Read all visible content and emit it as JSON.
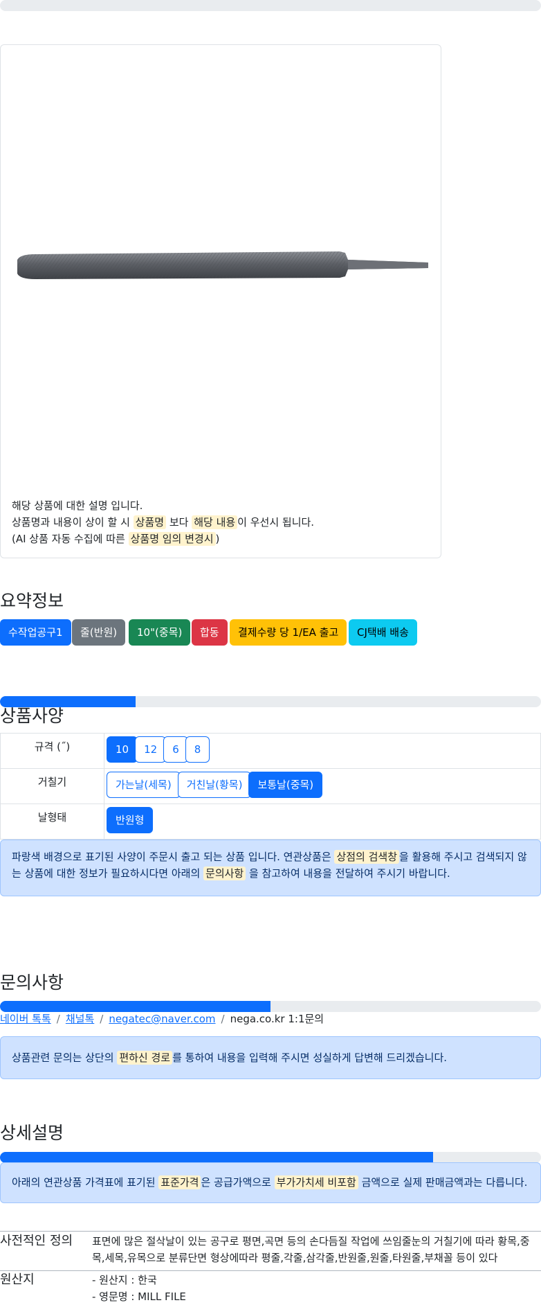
{
  "progress": {
    "top_fill": 0.0,
    "spec_fill": 0.25,
    "inquiry_fill": 0.5,
    "detail_fill": 0.8
  },
  "product_description": {
    "line1": "해당 상품에 대한 설명 입니다.",
    "line2_a": "상품명과 내용이 상이 할 시 ",
    "line2_hl1": "상품명",
    "line2_b": " 보다 ",
    "line2_hl2": "해당 내용",
    "line2_c": "이 우선시 됩니다.",
    "line3_a": "(AI 상품 자동 수집에 따른 ",
    "line3_hl": "상품명 임의 변경시",
    "line3_b": ")"
  },
  "summary": {
    "heading": "요약정보",
    "badges": [
      {
        "label": "수작업공구1",
        "color": "#0d6efd",
        "text_color": "#ffffff"
      },
      {
        "label": "줄(반원)",
        "color": "#6c757d",
        "text_color": "#ffffff"
      },
      {
        "label": "10\"(중목)",
        "color": "#198754",
        "text_color": "#ffffff"
      },
      {
        "label": "합동",
        "color": "#dc3545",
        "text_color": "#ffffff"
      },
      {
        "label": "결제수량 당 1/EA 출고",
        "color": "#ffc107",
        "text_color": "#000000"
      },
      {
        "label": "CJ택배 배송",
        "color": "#0dcaf0",
        "text_color": "#000000"
      }
    ]
  },
  "spec": {
    "heading": "상품사양",
    "rows": [
      {
        "label": "규격 (˝)",
        "options": [
          "10",
          "12",
          "6",
          "8"
        ],
        "active": 0
      },
      {
        "label": "거칠기",
        "options": [
          "가는날(세목)",
          "거친날(황목)",
          "보통날(중목)"
        ],
        "active": 2
      },
      {
        "label": "날형태",
        "options": [
          "반원형"
        ],
        "active": 0
      }
    ],
    "notice_a": "파랑색 배경으로 표기된 사양이 주문시 출고 되는 상품 입니다. 연관상품은 ",
    "notice_hl1": "상점의 검색창",
    "notice_b": "을 활용해 주시고 검색되지 않는 상품에 대한 정보가 필요하시다면 아래의 ",
    "notice_hl2": "문의사항",
    "notice_c": " 을 참고하여 내용을 전달하여 주시기 바랍니다."
  },
  "inquiry": {
    "heading": "문의사항",
    "links": [
      "네이버 톡톡",
      "채널톡",
      "negatec@naver.com"
    ],
    "plain": "nega.co.kr 1:1문의",
    "separator": "/",
    "notice_a": "상품관련 문의는 상단의 ",
    "notice_hl": "편하신 경로",
    "notice_b": "를 통하여 내용을 입력해 주시면 성실하게 답변해 드리겠습니다."
  },
  "detail": {
    "heading": "상세설명",
    "notice_a": "아래의 연관상품 가격표에 표기된 ",
    "notice_hl1": "표준가격",
    "notice_b": "은 공급가액으로 ",
    "notice_hl2": "부가가치세 비포함",
    "notice_c": " 금액으로 실제 판매금액과는 다릅니다.",
    "definition_term": "사전적인 정의",
    "definition_text": "표면에 많은 절삭날이 있는 공구로 평면,곡면 등의 손다듬질 작업에 쓰임줄눈의 거칠기에 따라 황목,중목,세목,유목으로 분류단면 형상에따라 평줄,각줄,삼각줄,반원줄,원줄,타원줄,부채꼴 등이 있다",
    "origin_term": "원산지",
    "origin_line1": "- 원산지 : 한국",
    "origin_line2": "- 영문명 : MILL FILE"
  }
}
